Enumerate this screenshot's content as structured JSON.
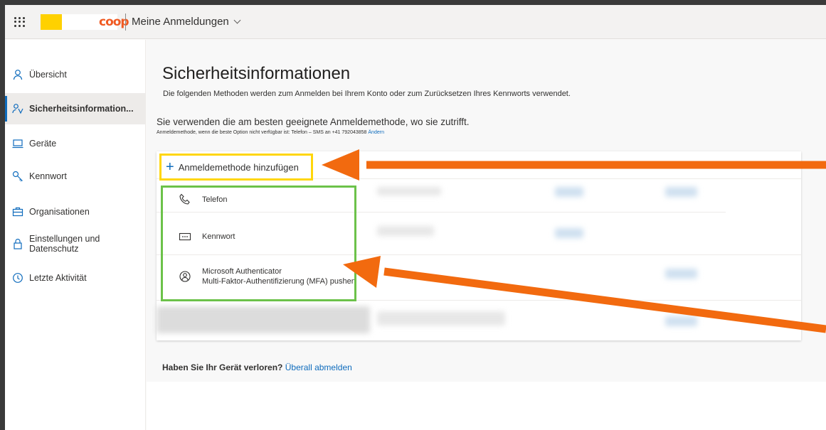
{
  "header": {
    "logo_text": "coop",
    "app_title": "Meine Anmeldungen"
  },
  "sidebar": {
    "items": [
      {
        "label": "Übersicht",
        "icon": "person-icon",
        "active": false
      },
      {
        "label": "Sicherheitsinformation...",
        "icon": "security-info-icon",
        "active": true
      },
      {
        "label": "Geräte",
        "icon": "laptop-icon",
        "active": false
      },
      {
        "label": "Kennwort",
        "icon": "key-icon",
        "active": false
      },
      {
        "label": "Organisationen",
        "icon": "briefcase-icon",
        "active": false
      },
      {
        "label": "Einstellungen und",
        "label2": "Datenschutz",
        "icon": "lock-icon",
        "active": false
      },
      {
        "label": "Letzte Aktivität",
        "icon": "history-icon",
        "active": false
      }
    ]
  },
  "main": {
    "title": "Sicherheitsinformationen",
    "subtitle": "Die folgenden Methoden werden zum Anmelden bei Ihrem Konto oder zum Zurücksetzen Ihres Kennworts verwendet.",
    "default_line": "Sie verwenden die am besten geeignete Anmeldemethode, wo sie zutrifft.",
    "default_small": "Anmeldemethode, wenn die beste Option nicht verfügbar ist: Telefon – SMS an +41 792043858",
    "default_change_link": "Ändern",
    "add_method_label": "Anmeldemethode hinzufügen",
    "methods": [
      {
        "title": "Telefon",
        "subtitle": "",
        "icon": "phone-icon"
      },
      {
        "title": "Kennwort",
        "subtitle": "",
        "icon": "password-icon"
      },
      {
        "title": "Microsoft Authenticator",
        "subtitle": "Multi-Faktor-Authentifizierung (MFA) pushen",
        "icon": "authenticator-icon"
      }
    ],
    "lost_device_text": "Haben Sie Ihr Gerät verloren?",
    "lost_device_link": "Überall abmelden"
  },
  "colors": {
    "accent": "#0f6cbd",
    "highlight_yellow": "#ffd60a",
    "highlight_green": "#6cc24a",
    "annotation_arrow": "#f26a0f",
    "brand_orange": "#f05a22"
  }
}
